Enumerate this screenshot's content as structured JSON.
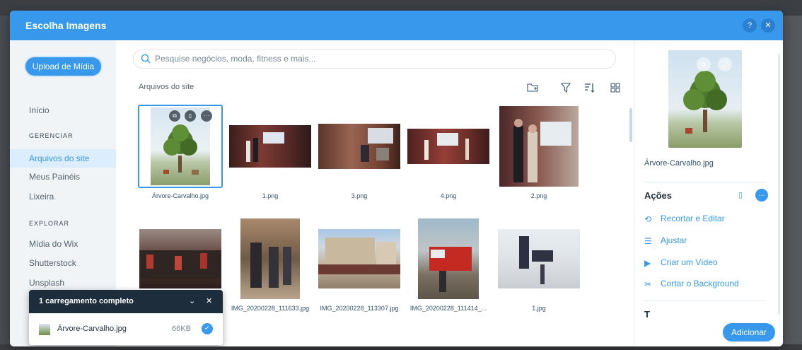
{
  "dialog": {
    "title": "Escolha Imagens",
    "help_icon": "question-icon",
    "close_icon": "close-icon"
  },
  "sidebar": {
    "upload_label": "Upload de Mídia",
    "home": "Início",
    "section_manage": "GERENCIAR",
    "manage_items": [
      "Arquivos do site",
      "Meus Painéis",
      "Lixeira"
    ],
    "section_explore": "EXPLORAR",
    "explore_items": [
      "Mídia do Wix",
      "Shutterstock",
      "Unsplash"
    ]
  },
  "search": {
    "placeholder": "Pesquise negócios, moda, fitness e mais..."
  },
  "main": {
    "breadcrumb": "Arquivos do site",
    "tools": [
      "new-folder-icon",
      "filter-icon",
      "sort-icon",
      "grid-view-icon"
    ]
  },
  "gallery": {
    "items": [
      {
        "name": "Árvore-Carvalho.jpg",
        "selected": true
      },
      {
        "name": "1.png"
      },
      {
        "name": "3.png"
      },
      {
        "name": "4.png"
      },
      {
        "name": "2.png"
      },
      {
        "name": "pg"
      },
      {
        "name": "IMG_20200228_111633.jpg"
      },
      {
        "name": "IMG_20200228_113307.jpg"
      },
      {
        "name": "IMG_20200228_111414_..."
      },
      {
        "name": "1.jpg"
      }
    ]
  },
  "details": {
    "file_name": "Árvore-Carvalho.jpg",
    "actions_title": "Ações",
    "actions": [
      "Recortar e Editar",
      "Ajustar",
      "Criar um Vídeo",
      "Cortar o Background"
    ],
    "next_section_initial": "T",
    "add_label": "Adicionar"
  },
  "upload_toast": {
    "title": "1 carregamento completo",
    "file_name": "Árvore-Carvalho.jpg",
    "file_size": "66KB"
  },
  "colors": {
    "accent": "#3899ec",
    "toast_header": "#1d2d3b",
    "sidebar_bg": "#f0f4f7",
    "active_nav": "#dceefd"
  }
}
